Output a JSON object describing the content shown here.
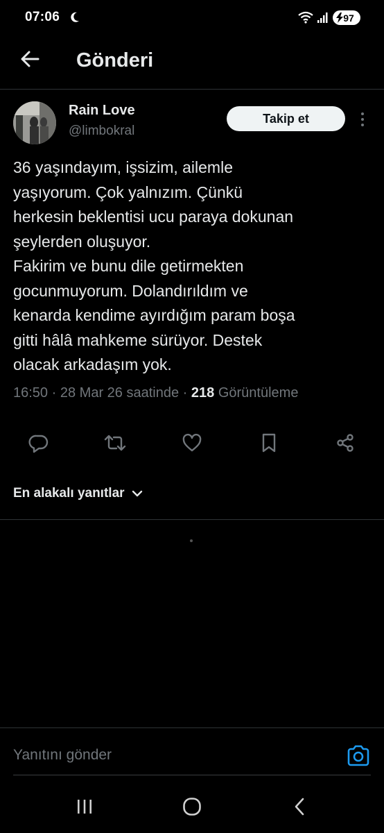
{
  "status_bar": {
    "time": "07:06",
    "battery": "97",
    "icons": [
      "moon-icon",
      "wifi-icon",
      "signal-icon",
      "battery-icon"
    ]
  },
  "header": {
    "title": "Gönderi",
    "back_icon": "arrow-left-icon"
  },
  "post": {
    "author_name": "Rain Love",
    "author_handle": "@limbokral",
    "follow_label": "Takip et",
    "more_icon": "more-vertical-icon",
    "text": "36 yaşındayım, işsizim, ailemle\nyaşıyorum. Çok yalnızım. Çünkü\nherkesin beklentisi ucu paraya dokunan\nşeylerden oluşuyor.\nFakirim ve bunu dile getirmekten\ngocunmuyorum. Dolandırıldım ve\nkenarda kendime ayırdığım param boşa\ngitti hâlâ mahkeme sürüyor. Destek\nolacak arkadaşım yok.",
    "time": "16:50",
    "sep1": "·",
    "date": "28 Mar 26 saatinde",
    "sep2": "·",
    "views_count": "218",
    "views_label": "Görüntüleme"
  },
  "actions": [
    {
      "icon": "reply-icon"
    },
    {
      "icon": "retweet-icon"
    },
    {
      "icon": "like-icon"
    },
    {
      "icon": "bookmark-icon"
    },
    {
      "icon": "share-icon"
    }
  ],
  "replies": {
    "sort_label": "En alakalı yanıtlar",
    "sort_icon": "chevron-down-icon"
  },
  "composer": {
    "placeholder": "Yanıtını gönder",
    "camera_icon": "camera-icon"
  },
  "navbar": {
    "icons": [
      "recent-apps-icon",
      "home-icon",
      "back-icon"
    ]
  },
  "colors": {
    "background": "#000000",
    "text_primary": "#e7e9ea",
    "text_secondary": "#71767b",
    "accent": "#1d9bf0",
    "divider": "#2f3336"
  }
}
